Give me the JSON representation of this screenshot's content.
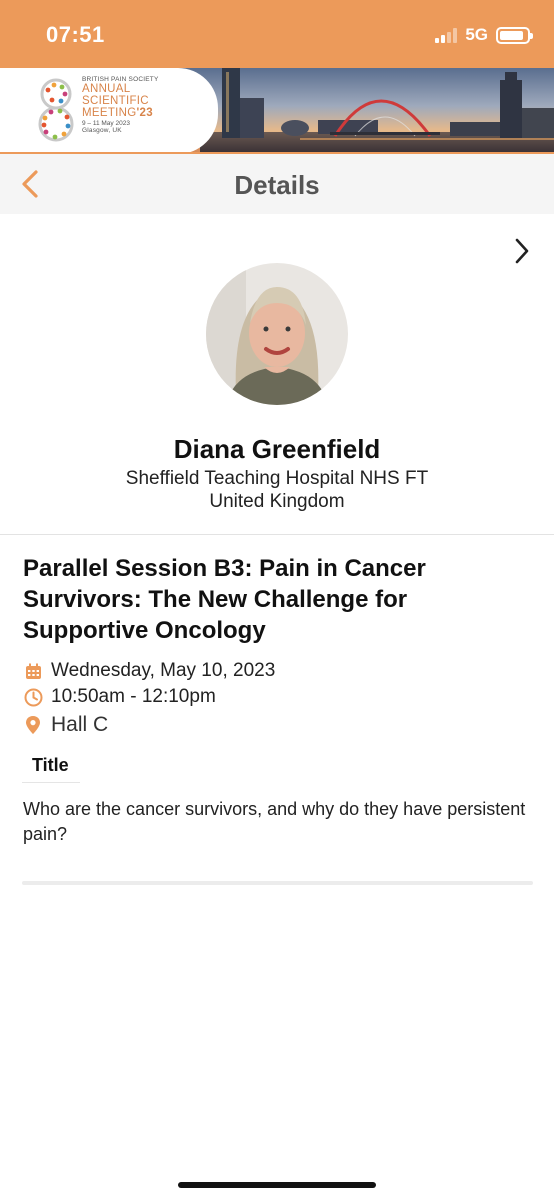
{
  "status_bar": {
    "time": "07:51",
    "network": "5G",
    "signal_bars_active": 2,
    "signal_bars_total": 4,
    "battery_level": 0.9,
    "background_color": "#ec9a5a"
  },
  "banner": {
    "org": "BRITISH PAIN SOCIETY",
    "line1": "ANNUAL",
    "line2": "SCIENTIFIC",
    "line3": "MEETING",
    "year": "'23",
    "dates": "9 – 11 May 2023",
    "location": "Glasgow, UK",
    "accent_color": "#d8844a"
  },
  "navbar": {
    "back_icon": "chevron-left-icon",
    "title": "Details"
  },
  "next_icon": "chevron-right-icon",
  "speaker": {
    "name": "Diana Greenfield",
    "organization": "Sheffield Teaching Hospital NHS FT",
    "country": "United Kingdom"
  },
  "session": {
    "title": "Parallel Session B3: Pain in Cancer Survivors: The New Challenge for Supportive Oncology",
    "date": "Wednesday, May 10, 2023",
    "time": "10:50am - 12:10pm",
    "location": "Hall C",
    "icon_color": "#ec9a5a"
  },
  "tab_label": "Title",
  "abstract_title": "Who are the cancer survivors, and why do they have persistent pain?"
}
